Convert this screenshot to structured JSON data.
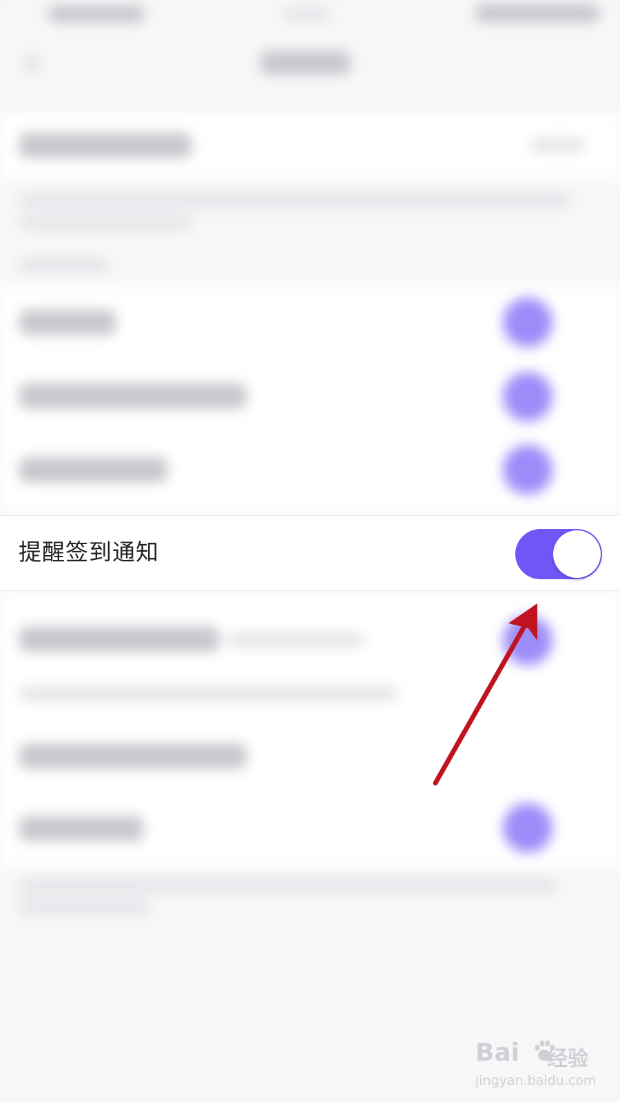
{
  "setting_row": {
    "label": "提醒签到通知",
    "toggle_on": true
  },
  "colors": {
    "accent": "#7255f6",
    "blurred_toggle": "#9d8cf9",
    "annotation_arrow": "#c1121f",
    "background": "#f6f6f8"
  },
  "watermark": {
    "logo_text": "Bai",
    "logo_suffix": "经验",
    "url": "jingyan.baidu.com"
  }
}
